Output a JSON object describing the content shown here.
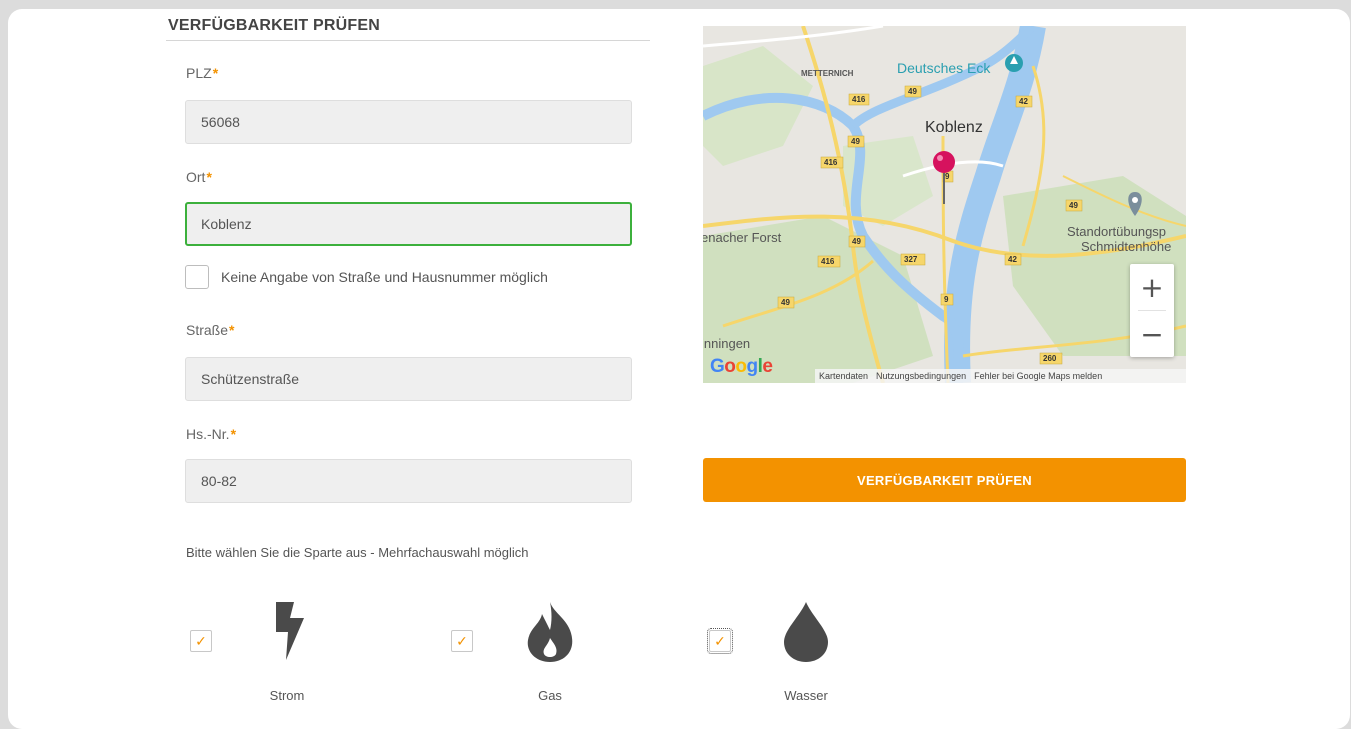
{
  "section": {
    "title": "VERFÜGBARKEIT PRÜFEN"
  },
  "form": {
    "plz_label": "PLZ",
    "plz_value": "56068",
    "ort_label": "Ort",
    "ort_value": "Koblenz",
    "no_street_label": "Keine Angabe von Straße und Hausnummer möglich",
    "strasse_label": "Straße",
    "strasse_value": "Schützenstraße",
    "hsnr_label": "Hs.-Nr.",
    "hsnr_value": "80-82",
    "required_marker": "*"
  },
  "map": {
    "place_labels": {
      "metternich": "METTERNICH",
      "deutsches_eck": "Deutsches Eck",
      "koblenz": "Koblenz",
      "forst": "enacher Forst",
      "standort1": "Standortübungsp",
      "standort2": "Schmidtenhöhe",
      "inningen": "inningen"
    },
    "road_numbers": [
      "416",
      "49",
      "42",
      "49",
      "416",
      "49",
      "49",
      "416",
      "327",
      "42",
      "9",
      "49",
      "260",
      "9"
    ],
    "google": "Google",
    "footer": {
      "kartendaten": "Kartendaten",
      "nutzung": "Nutzungsbedingungen",
      "fehler": "Fehler bei Google Maps melden"
    },
    "zoom_in": "+",
    "zoom_out": "−",
    "colors": {
      "water": "#9fc9f0",
      "land": "#e8e6e1",
      "green": "#c9dfb6",
      "road": "#f6d66b"
    }
  },
  "action": {
    "check_button": "VERFÜGBARKEIT PRÜFEN"
  },
  "sparte": {
    "hint": "Bitte wählen Sie die Sparte aus - Mehrfachauswahl möglich",
    "check_mark": "✓",
    "options": [
      {
        "label": "Strom",
        "icon": "lightning-icon",
        "checked": true
      },
      {
        "label": "Gas",
        "icon": "flame-icon",
        "checked": true
      },
      {
        "label": "Wasser",
        "icon": "water-drop-icon",
        "checked": true
      }
    ]
  },
  "colors": {
    "accent": "#f39200",
    "focus_border": "#3cb03c"
  }
}
